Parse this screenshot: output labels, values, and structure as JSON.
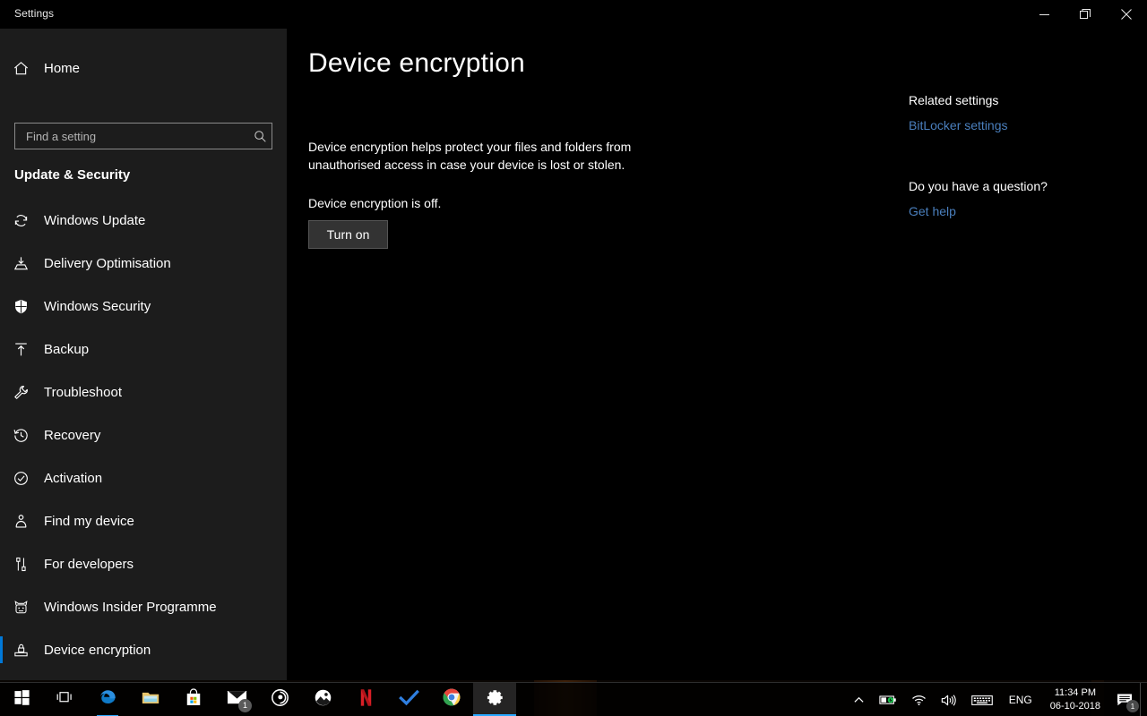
{
  "window": {
    "title": "Settings",
    "controls": [
      {
        "name": "minimize",
        "label": "─"
      },
      {
        "name": "maximize",
        "label": "❐"
      },
      {
        "name": "close",
        "label": "✕"
      }
    ]
  },
  "sidebar": {
    "home_label": "Home",
    "home_icon": "home-icon",
    "search": {
      "placeholder": "Find a setting",
      "value": "",
      "icon": "search-icon"
    },
    "category_title": "Update & Security",
    "items": [
      {
        "label": "Windows Update",
        "icon": "refresh-icon",
        "selected": false
      },
      {
        "label": "Delivery Optimisation",
        "icon": "download-icon",
        "selected": false
      },
      {
        "label": "Windows Security",
        "icon": "shield-icon",
        "selected": false
      },
      {
        "label": "Backup",
        "icon": "upload-icon",
        "selected": false
      },
      {
        "label": "Troubleshoot",
        "icon": "wrench-icon",
        "selected": false
      },
      {
        "label": "Recovery",
        "icon": "history-icon",
        "selected": false
      },
      {
        "label": "Activation",
        "icon": "check-circle-icon",
        "selected": false
      },
      {
        "label": "Find my device",
        "icon": "person-pin-icon",
        "selected": false
      },
      {
        "label": "For developers",
        "icon": "tools-icon",
        "selected": false
      },
      {
        "label": "Windows Insider Programme",
        "icon": "insider-cat-icon",
        "selected": false
      },
      {
        "label": "Device encryption",
        "icon": "device-lock-icon",
        "selected": true
      }
    ],
    "accent_color": "#0078d7"
  },
  "main": {
    "page_title": "Device encryption",
    "description": "Device encryption helps protect your files and folders from unauthorised access in case your device is lost or stolen.",
    "status_text": "Device encryption is off.",
    "turn_on_label": "Turn on"
  },
  "rail": {
    "related_heading": "Related settings",
    "bitlocker_link": "BitLocker settings",
    "question_heading": "Do you have a question?",
    "get_help_link": "Get help",
    "link_color": "#4a7fbd"
  },
  "taskbar": {
    "buttons": [
      {
        "name": "start-button",
        "icon": "windows-logo-icon",
        "state": "idle"
      },
      {
        "name": "task-view-button",
        "icon": "task-view-icon",
        "state": "idle"
      },
      {
        "name": "edge-button",
        "icon": "edge-icon",
        "state": "running"
      },
      {
        "name": "file-explorer-button",
        "icon": "folder-icon",
        "state": "idle"
      },
      {
        "name": "microsoft-store-button",
        "icon": "store-bag-icon",
        "state": "idle"
      },
      {
        "name": "mail-button",
        "icon": "mail-icon",
        "state": "idle",
        "badge": "1"
      },
      {
        "name": "groove-music-button",
        "icon": "groove-music-icon",
        "state": "idle"
      },
      {
        "name": "photos-button",
        "icon": "photos-icon",
        "state": "idle"
      },
      {
        "name": "netflix-button",
        "icon": "netflix-n-icon",
        "state": "idle"
      },
      {
        "name": "todo-button",
        "icon": "checkmark-icon",
        "state": "idle"
      },
      {
        "name": "chrome-button",
        "icon": "chrome-icon",
        "state": "idle"
      },
      {
        "name": "settings-button",
        "icon": "gear-icon",
        "state": "active"
      }
    ],
    "tray": {
      "overflow_icon": "chevron-up-icon",
      "battery_icon": "battery-icon",
      "network_icon": "wifi-icon",
      "volume_icon": "speaker-icon",
      "keyboard_icon": "keyboard-icon",
      "language": "ENG",
      "time": "11:34 PM",
      "date": "06-10-2018",
      "notification_icon": "action-center-icon",
      "notification_count": "1"
    }
  }
}
